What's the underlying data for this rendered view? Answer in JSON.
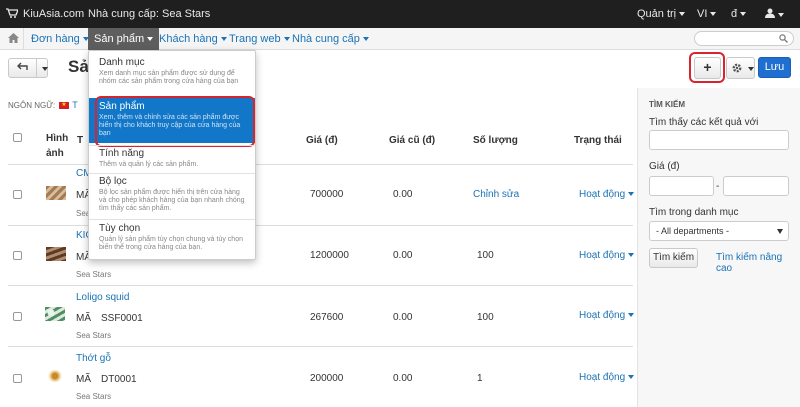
{
  "topbar": {
    "brand": "KiuAsia.com",
    "supplier": "Nhà cung cấp: Sea Stars",
    "admin": "Quản trị",
    "lang": "VI",
    "currency": "đ"
  },
  "nav": {
    "items": [
      "Đơn hàng",
      "Sản phẩm",
      "Khách hàng",
      "Trang web",
      "Nhà cung cấp"
    ]
  },
  "toolbar": {
    "title_partial": "Sả",
    "add_button": "+",
    "save_button": "Lưu"
  },
  "dropdown": {
    "items": [
      {
        "title": "Danh mục",
        "desc": "Xem danh mục sản phẩm được sử dụng để nhóm các sản phẩm trong cửa hàng của bạn"
      },
      {
        "title": "Sản phẩm",
        "desc": "Xem, thêm và chỉnh sửa các sản phẩm được hiển thị cho khách truy cập của cửa hàng của bạn"
      },
      {
        "title": "Tính năng",
        "desc": "Thêm và quản lý các sản phẩm."
      },
      {
        "title": "Bộ lọc",
        "desc": "Bộ lọc sản phẩm được hiển thị trên cửa hàng và cho phép khách hàng của bạn nhanh chóng tìm thấy các sản phẩm."
      },
      {
        "title": "Tùy chọn",
        "desc": "Quản lý sản phẩm tùy chọn chung và tùy chọn biến thể trong cửa hàng của bạn."
      }
    ]
  },
  "language": {
    "label": "NGÔN NGỮ:",
    "value": "T"
  },
  "table": {
    "headers": {
      "image": "Hình ảnh",
      "name_partial": "T",
      "price": "Giá (đ)",
      "old_price": "Giá cũ (đ)",
      "qty": "Số lượng",
      "status": "Trạng thái"
    },
    "code_prefix": "MÃ",
    "rows": [
      {
        "name": "CM",
        "code": "",
        "supplier": "Sea Stars",
        "price": "700000",
        "old": "0.00",
        "qty": "Chỉnh sửa",
        "status": "Hoạt động"
      },
      {
        "name": "KIO",
        "code": "",
        "supplier": "Sea Stars",
        "price": "1200000",
        "old": "0.00",
        "qty": "100",
        "status": "Hoạt động"
      },
      {
        "name": "Loligo squid",
        "code": "SSF0001",
        "supplier": "Sea Stars",
        "price": "267600",
        "old": "0.00",
        "qty": "100",
        "status": "Hoạt động"
      },
      {
        "name": "Thớt gỗ",
        "code": "DT0001",
        "supplier": "Sea Stars",
        "price": "200000",
        "old": "0.00",
        "qty": "1",
        "status": "Hoạt động"
      }
    ]
  },
  "sidebar": {
    "heading": "TÌM KIẾM",
    "find_label": "Tìm thấy các kết quả với",
    "price_label": "Giá (đ)",
    "range_sep": "-",
    "category_label": "Tìm trong danh mục",
    "category_value": "- All departments -",
    "search_button": "Tìm kiếm",
    "advanced_link": "Tìm kiếm nâng cao"
  }
}
